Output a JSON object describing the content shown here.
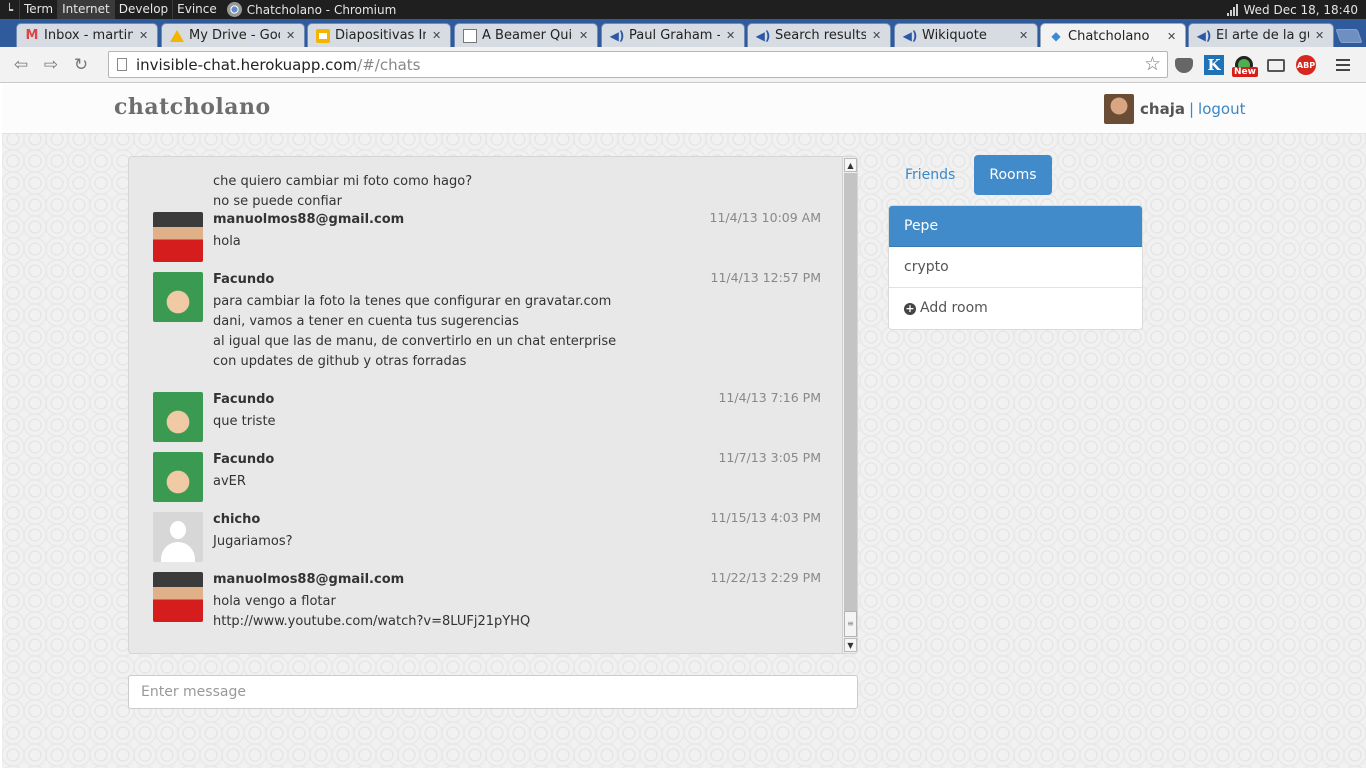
{
  "os_bar": {
    "menus": [
      "Term",
      "Internet",
      "Develop",
      "Evince"
    ],
    "window_title": "Chatcholano - Chromium",
    "clock": "Wed Dec 18, 18:40"
  },
  "tabs": [
    {
      "label": "Inbox - martin.c",
      "icon": "gmail-icon"
    },
    {
      "label": "My Drive - Goog",
      "icon": "drive-icon"
    },
    {
      "label": "Diapositivas Inv",
      "icon": "slides-icon"
    },
    {
      "label": "A Beamer Quicl",
      "icon": "document-icon"
    },
    {
      "label": "Paul Graham - '",
      "icon": "audio-icon"
    },
    {
      "label": "Search results",
      "icon": "audio-icon"
    },
    {
      "label": "Wikiquote",
      "icon": "audio-icon"
    },
    {
      "label": "Chatcholano",
      "icon": "chat-icon",
      "active": true
    },
    {
      "label": "El arte de la gu",
      "icon": "audio-icon"
    }
  ],
  "toolbar": {
    "url_host": "invisible-chat.herokuapp.com",
    "url_path": "/#/chats",
    "new_badge": "New",
    "abp_label": "ABP",
    "k_label": "K"
  },
  "app": {
    "brand": "chatcholano",
    "user_name": "chaja",
    "separator": "|",
    "logout": "logout"
  },
  "messages": [
    {
      "author": "",
      "time": "",
      "avatar": "partial",
      "lines": [
        "che quiero cambiar mi foto como hago?",
        "no se puede confiar"
      ]
    },
    {
      "author": "manuolmos88@gmail.com",
      "time": "11/4/13 10:09 AM",
      "avatar": "arsenal",
      "lines": [
        "hola"
      ]
    },
    {
      "author": "Facundo",
      "time": "11/4/13 12:57 PM",
      "avatar": "facundo",
      "lines": [
        "para cambiar la foto la tenes que configurar en gravatar.com",
        "dani, vamos a tener en cuenta tus sugerencias",
        "al igual que las de manu, de convertirlo en un chat enterprise",
        "con updates de github y otras forradas"
      ]
    },
    {
      "author": "Facundo",
      "time": "11/4/13 7:16 PM",
      "avatar": "facundo",
      "lines": [
        "que triste"
      ]
    },
    {
      "author": "Facundo",
      "time": "11/7/13 3:05 PM",
      "avatar": "facundo",
      "lines": [
        "avER"
      ]
    },
    {
      "author": "chicho",
      "time": "11/15/13 4:03 PM",
      "avatar": "default",
      "lines": [
        "Jugariamos?"
      ]
    },
    {
      "author": "manuolmos88@gmail.com",
      "time": "11/22/13 2:29 PM",
      "avatar": "arsenal",
      "lines": [
        "hola vengo a flotar",
        "http://www.youtube.com/watch?v=8LUFj21pYHQ"
      ]
    }
  ],
  "composer": {
    "placeholder": "Enter message",
    "value": ""
  },
  "sidebar": {
    "tabs": [
      "Friends",
      "Rooms"
    ],
    "active_tab": "Rooms",
    "rooms": [
      "Pepe",
      "crypto"
    ],
    "active_room": "Pepe",
    "add_room": "Add room"
  }
}
